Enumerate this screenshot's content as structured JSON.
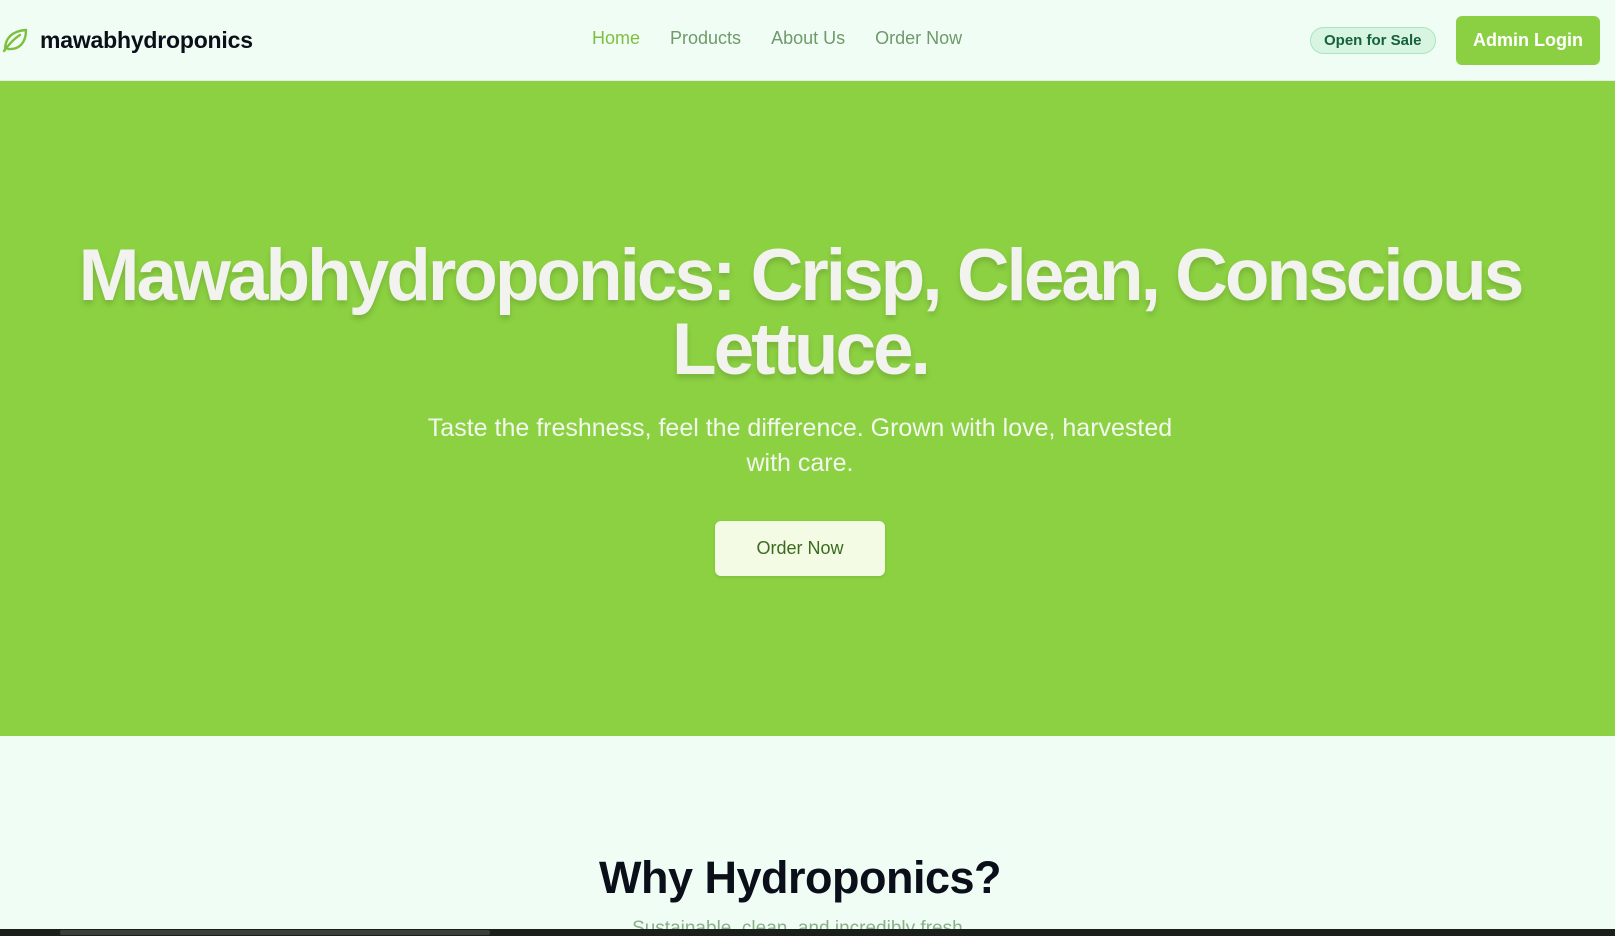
{
  "brand": {
    "name": "mawabhydroponics",
    "icon": "leaf-icon",
    "accent_color": "#8cd142"
  },
  "nav": {
    "links": [
      {
        "label": "Home",
        "active": true
      },
      {
        "label": "Products",
        "active": false
      },
      {
        "label": "About Us",
        "active": false
      },
      {
        "label": "Order Now",
        "active": false
      }
    ]
  },
  "status": {
    "label": "Open for Sale",
    "color": "#15613a"
  },
  "admin": {
    "label": "Admin Login"
  },
  "hero": {
    "title_line1": "Mawabhydroponics: Crisp, Clean, Conscious",
    "title_line2": "Lettuce.",
    "subtitle_line1": "Taste the freshness, feel the difference. Grown with love, harvested",
    "subtitle_line2": "with care.",
    "cta_label": "Order Now",
    "background_color": "#8cd142"
  },
  "why": {
    "title": "Why Hydroponics?",
    "subtitle": "Sustainable, clean, and incredibly fresh."
  }
}
